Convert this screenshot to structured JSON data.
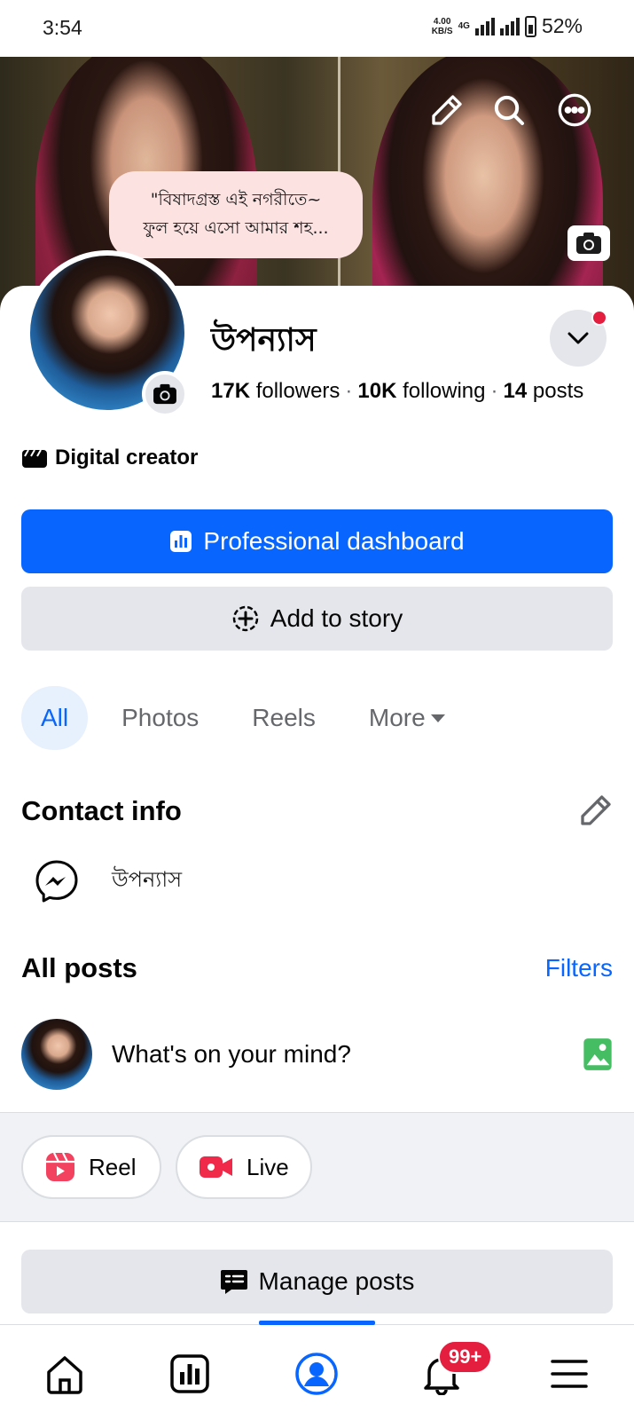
{
  "status_bar": {
    "time": "3:54",
    "net_speed_top": "4.00",
    "net_speed_bottom": "KB/S",
    "network": "4G",
    "battery": "52%"
  },
  "cover": {
    "icons": [
      "edit-icon",
      "search-icon",
      "more-icon",
      "camera-icon"
    ]
  },
  "note": {
    "line1": "\"বিষাদগ্রস্ত এই নগরীতে~",
    "line2": "ফুল হয়ে এসো আমার শহ..."
  },
  "profile": {
    "name": "উপন্যাস",
    "followers_count": "17K",
    "followers_label": "followers",
    "following_count": "10K",
    "following_label": "following",
    "posts_count": "14",
    "posts_label": "posts",
    "separator": "·",
    "category": "Digital creator"
  },
  "actions": {
    "primary": "Professional dashboard",
    "secondary": "Add to story"
  },
  "tabs": [
    {
      "label": "All",
      "active": true
    },
    {
      "label": "Photos",
      "active": false
    },
    {
      "label": "Reels",
      "active": false
    },
    {
      "label": "More",
      "active": false
    }
  ],
  "contact_info": {
    "title": "Contact info",
    "messenger": "উপন্যাস"
  },
  "posts": {
    "title": "All posts",
    "filters": "Filters",
    "composer_prompt": "What's on your mind?",
    "reel": "Reel",
    "live": "Live",
    "manage": "Manage posts"
  },
  "bottom_nav": {
    "items": [
      "home-icon",
      "dashboard-icon",
      "profile-icon",
      "notifications-icon",
      "menu-icon"
    ],
    "notification_badge": "99+"
  },
  "colors": {
    "accent": "#0866ff",
    "secondary_button": "#e4e6eb",
    "badge": "#e41e3f",
    "note_bubble": "#fde2e2"
  }
}
